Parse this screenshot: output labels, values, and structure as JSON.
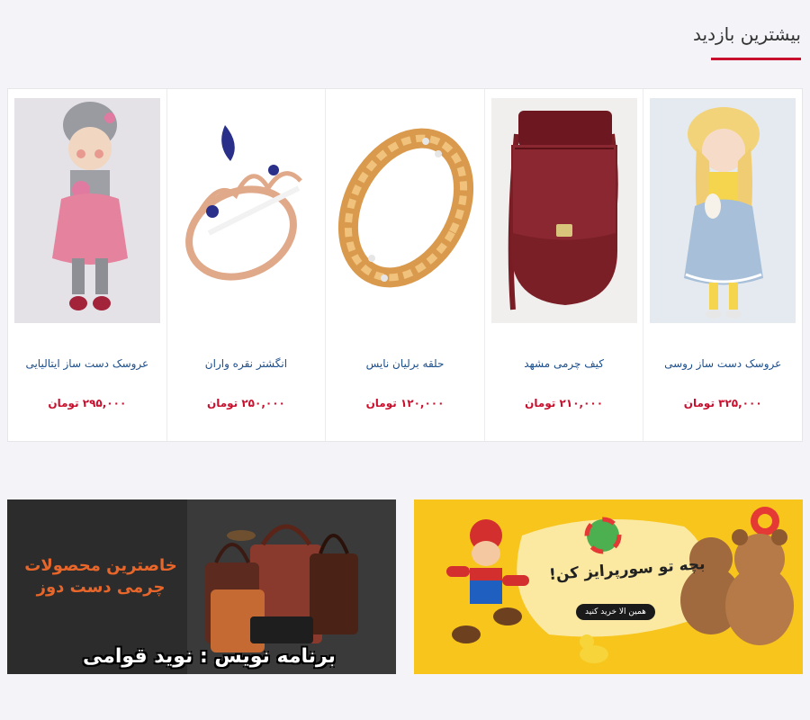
{
  "section": {
    "title": "بیشترین بازدید"
  },
  "products": [
    {
      "name": "عروسک دست ساز روسی",
      "price": "۳۲۵,۰۰۰ تومان",
      "image": "russian-doll-image"
    },
    {
      "name": "کیف چرمی مشهد",
      "price": "۲۱۰,۰۰۰ تومان",
      "image": "leather-bag-image"
    },
    {
      "name": "حلقه برلیان نایس",
      "price": "۱۲۰,۰۰۰ تومان",
      "image": "gold-ring-image"
    },
    {
      "name": "انگشتر نقره واران",
      "price": "۲۵۰,۰۰۰ تومان",
      "image": "crown-ring-image"
    },
    {
      "name": "عروسک دست ساز ایتالیایی",
      "price": "۲۹۵,۰۰۰ تومان",
      "image": "italian-doll-image"
    }
  ],
  "banners": {
    "toys": {
      "headline": "بچه تو سورپرایز کن!",
      "cta": "همین الا خرید کنید"
    },
    "leather": {
      "headline_line1": "خاصترین محصولات",
      "headline_line2": "چرمی دست دوز",
      "credit": "برنامه نویس : نوید قوامی"
    }
  },
  "colors": {
    "accent": "#c8102e",
    "link": "#1b4e8c",
    "background": "#f4f4f8"
  }
}
